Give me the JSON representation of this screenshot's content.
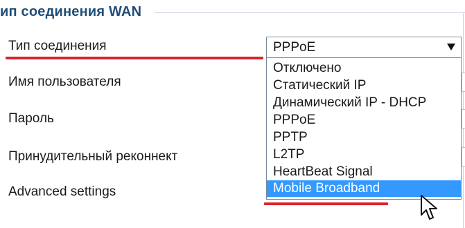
{
  "section": {
    "title": "ип соединения WAN"
  },
  "form": {
    "connection_type_label": "Тип соединения",
    "username_label": "Имя пользователя",
    "password_label": "Пароль",
    "forced_reconnect_label": "Принудительный реконнект",
    "advanced_settings_label": "Advanced settings"
  },
  "select": {
    "current_value": "PPPoE",
    "options": [
      "Отключено",
      "Статический IP",
      "Динамический IP - DHCP",
      "PPPoE",
      "PPTP",
      "L2TP",
      "HeartBeat Signal",
      "Mobile Broadband"
    ],
    "highlighted_option": "Mobile Broadband"
  },
  "colors": {
    "title": "#1f4e79",
    "highlight": "#3399ff",
    "annotation_underline": "#d8242c"
  },
  "icons": {
    "select_arrow": "triangle-down-icon",
    "mouse_cursor": "mouse-pointer-icon"
  }
}
